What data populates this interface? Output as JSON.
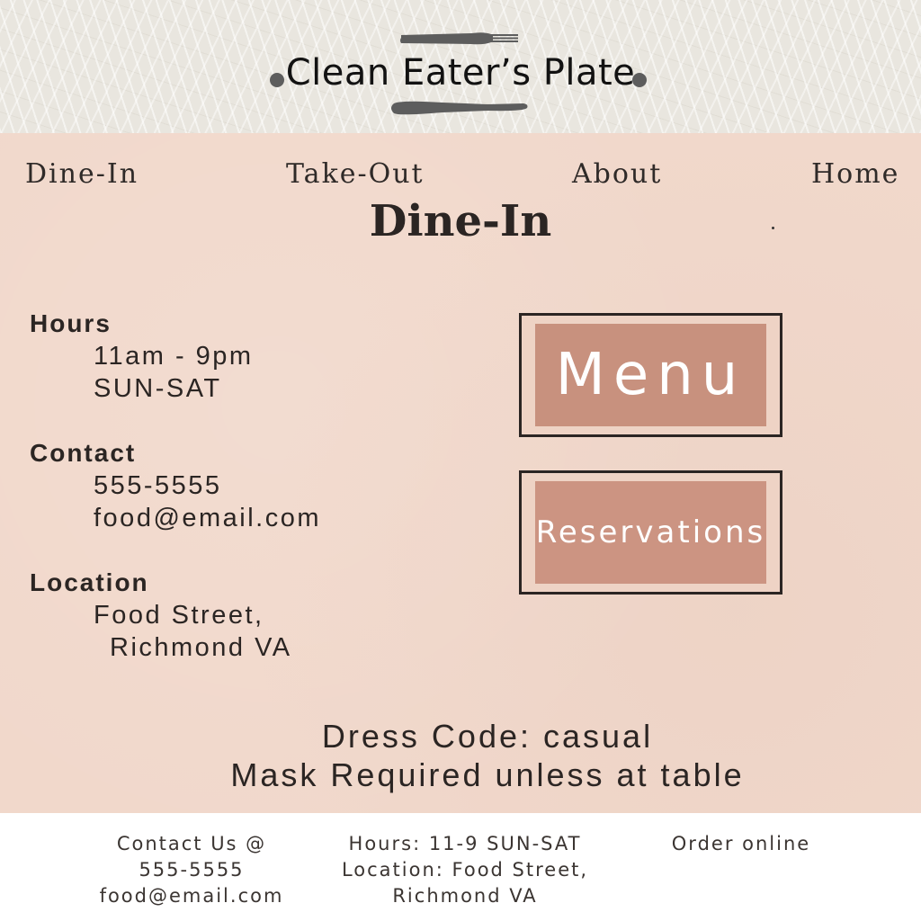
{
  "header": {
    "brand": "Clean Eater’s Plate",
    "icons": {
      "fork": "fork-icon",
      "knife": "knife-icon"
    }
  },
  "nav": {
    "items": [
      {
        "label": "Dine-In"
      },
      {
        "label": "Take-Out"
      },
      {
        "label": "About"
      },
      {
        "label": "Home"
      }
    ]
  },
  "page": {
    "title": "Dine-In"
  },
  "info": {
    "hours": {
      "heading": "Hours",
      "lines": [
        "11am - 9pm",
        "SUN-SAT"
      ]
    },
    "contact": {
      "heading": "Contact",
      "lines": [
        "555-5555",
        "food@email.com"
      ]
    },
    "location": {
      "heading": "Location",
      "lines": [
        "Food Street,",
        "Richmond VA"
      ]
    }
  },
  "buttons": {
    "menu": "Menu",
    "reservations": "Reservations"
  },
  "notices": {
    "dress_code": "Dress Code: casual",
    "mask": "Mask Required unless at table"
  },
  "footer": {
    "contact": {
      "line1": "Contact Us @",
      "line2": "555-5555",
      "line3": "food@email.com"
    },
    "hours": {
      "line1": "Hours: 11-9 SUN-SAT",
      "line2": "Location: Food Street,",
      "line3": "Richmond VA"
    },
    "order": "Order online"
  },
  "colors": {
    "background": "#f1d8cb",
    "button_fill": "#c8917e",
    "text": "#2b2523",
    "header_bg": "#e9e6df"
  }
}
